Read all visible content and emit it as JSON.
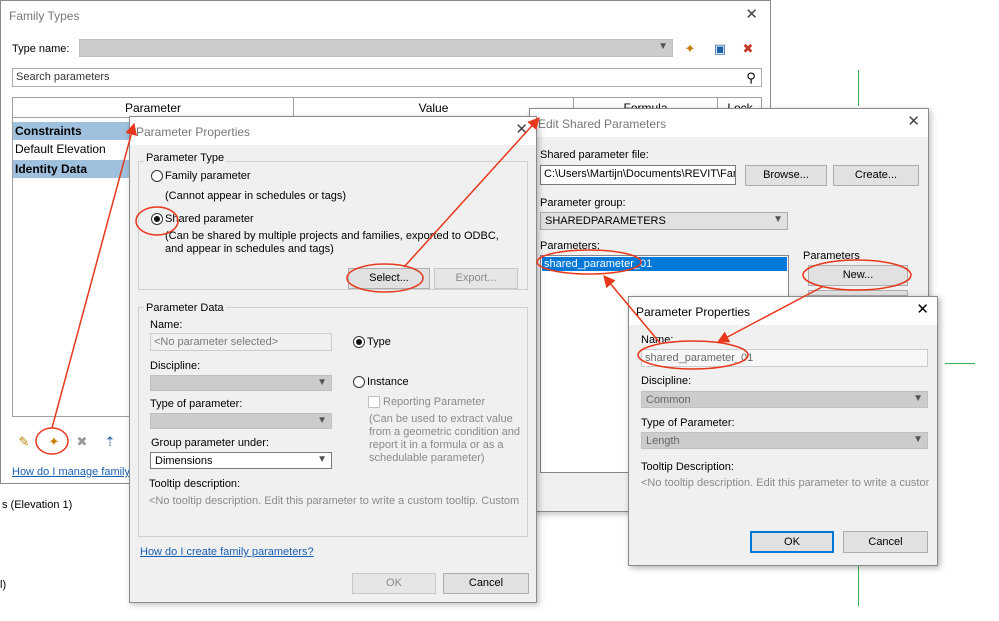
{
  "family_types": {
    "title": "Family Types",
    "close": "✕",
    "type_name_label": "Type name:",
    "search_placeholder": "Search parameters",
    "columns": [
      "Parameter",
      "Value",
      "Formula",
      "Lock"
    ],
    "rows": [
      {
        "label": "Constraints",
        "kind": "category"
      },
      {
        "label": "Default Elevation",
        "kind": "plain"
      },
      {
        "label": "Identity Data",
        "kind": "category"
      }
    ],
    "help_link": "How do I manage family ty",
    "toolbar_icons": [
      "pencil-icon",
      "new-parameter-icon",
      "delete-parameter-icon",
      "sort-ascending-icon"
    ]
  },
  "background_texts": [
    "s (Elevation 1)",
    "l)"
  ],
  "param_props_1": {
    "title": "Parameter Properties",
    "close": "✕",
    "parameter_type_label": "Parameter Type",
    "family_parameter_label": "Family parameter",
    "family_parameter_note": "(Cannot appear in schedules or tags)",
    "shared_parameter_label": "Shared parameter",
    "shared_parameter_note": "(Can be shared by multiple projects and families, exported to ODBC, and appear in schedules and tags)",
    "select_button": "Select...",
    "export_button": "Export...",
    "parameter_data_label": "Parameter Data",
    "name_label": "Name:",
    "name_placeholder": "<No parameter selected>",
    "type_radio": "Type",
    "discipline_label": "Discipline:",
    "instance_radio": "Instance",
    "reporting_parameter": "Reporting Parameter",
    "reporting_note": "(Can be used to extract value from a geometric condition and report it in a formula or as a schedulable parameter)",
    "type_of_parameter_label": "Type of parameter:",
    "group_under_label": "Group parameter under:",
    "group_under_value": "Dimensions",
    "tooltip_label": "Tooltip description:",
    "tooltip_placeholder": "<No tooltip description. Edit this parameter to write a custom tooltip. Custom too...",
    "help_link": "How do I create family parameters?",
    "ok_button": "OK",
    "cancel_button": "Cancel"
  },
  "edit_shared": {
    "title": "Edit Shared Parameters",
    "close": "✕",
    "file_label": "Shared parameter file:",
    "file_value": "C:\\Users\\Martijn\\Documents\\REVIT\\Familie",
    "browse_button": "Browse...",
    "create_button": "Create...",
    "group_label": "Parameter group:",
    "group_value": "SHAREDPARAMETERS",
    "parameters_label": "Parameters:",
    "selected_parameter": "shared_parameter_01",
    "side_group_label": "Parameters",
    "new_button": "New..."
  },
  "param_props_2": {
    "title": "Parameter Properties",
    "close": "✕",
    "name_label": "Name:",
    "name_value": "shared_parameter_01",
    "discipline_label": "Discipline:",
    "discipline_value": "Common",
    "type_label": "Type of Parameter:",
    "type_value": "Length",
    "tooltip_label": "Tooltip Description:",
    "tooltip_placeholder": "<No tooltip description. Edit this parameter to write a custom ...",
    "ok_button": "OK",
    "cancel_button": "Cancel"
  },
  "colors": {
    "annotation_red": "#e8381b",
    "category_row": "#9fc1dd",
    "selection_blue": "#0078d7",
    "guide_green": "#3cb44b"
  }
}
